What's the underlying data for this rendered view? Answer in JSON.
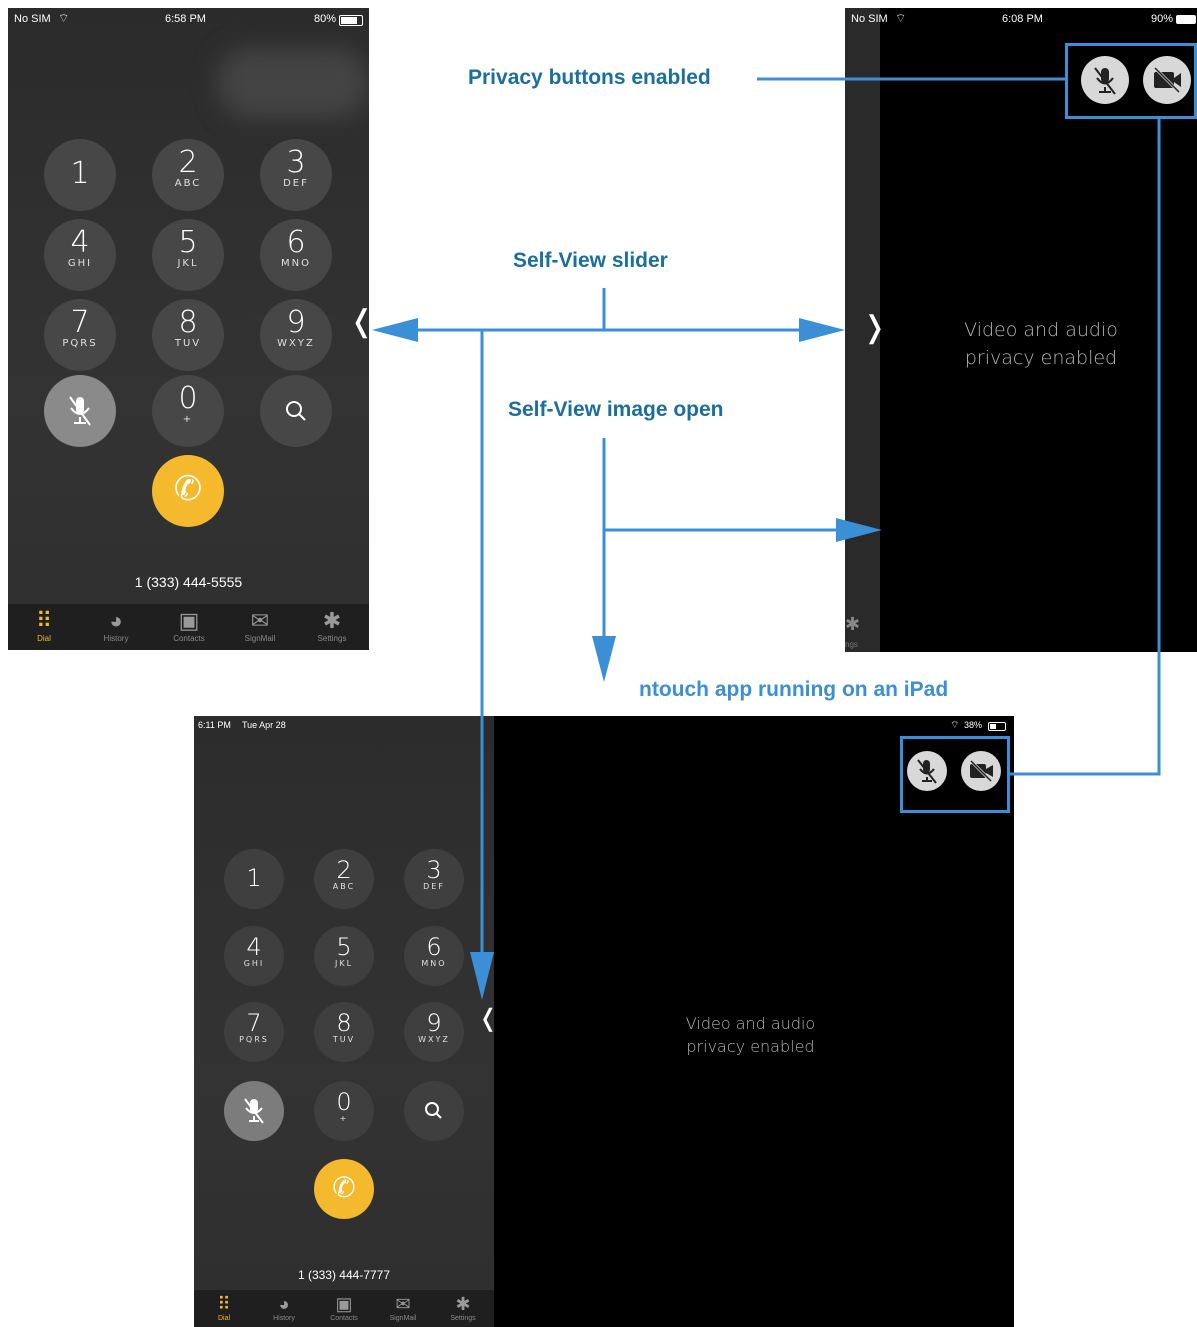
{
  "phone1": {
    "status": {
      "carrier": "No SIM",
      "time": "6:58 PM",
      "battery": "80%"
    },
    "keys": [
      {
        "digit": "1",
        "letters": ""
      },
      {
        "digit": "2",
        "letters": "ABC"
      },
      {
        "digit": "3",
        "letters": "DEF"
      },
      {
        "digit": "4",
        "letters": "GHI"
      },
      {
        "digit": "5",
        "letters": "JKL"
      },
      {
        "digit": "6",
        "letters": "MNO"
      },
      {
        "digit": "7",
        "letters": "PQRS"
      },
      {
        "digit": "8",
        "letters": "TUV"
      },
      {
        "digit": "9",
        "letters": "WXYZ"
      },
      {
        "digit": "0",
        "letters": "+"
      }
    ],
    "dialed_number": "1 (333) 444-5555",
    "slider_glyph": "❬",
    "tabs": [
      "Dial",
      "History",
      "Contacts",
      "SignMail",
      "Settings"
    ]
  },
  "phone2": {
    "status": {
      "carrier": "No SIM",
      "time": "6:08 PM",
      "battery": "90%"
    },
    "privacy_line1": "Video and audio",
    "privacy_line2": "privacy enabled",
    "slider_glyph": "❭",
    "tab_fragment": "ngs"
  },
  "ipad": {
    "status": {
      "time": "6:11 PM",
      "date": "Tue Apr 28",
      "battery": "38%"
    },
    "dialed_number": "1 (333) 444-7777",
    "privacy_line1": "Video and audio",
    "privacy_line2": "privacy enabled",
    "slider_glyph": "❬",
    "tabs": [
      "Dial",
      "History",
      "Contacts",
      "SignMail",
      "Settings"
    ]
  },
  "annotations": {
    "privacy": "Privacy buttons enabled",
    "slider": "Self-View slider",
    "image_open": "Self-View image open",
    "ipad": "ntouch app running on an iPad"
  },
  "colors": {
    "accent": "#f5b92e",
    "callout": "#3a8fd6",
    "label": "#1a6f9c"
  }
}
